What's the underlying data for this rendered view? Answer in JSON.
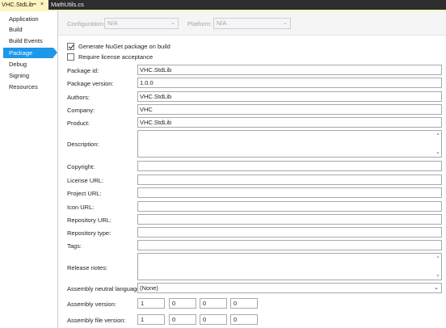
{
  "tabs": {
    "active": {
      "label": "VHC.StdLib",
      "pin": "⊸",
      "close": "×"
    },
    "inactive": {
      "label": "MathUtils.cs"
    }
  },
  "sidebar": {
    "items": [
      {
        "label": "Application"
      },
      {
        "label": "Build"
      },
      {
        "label": "Build Events"
      },
      {
        "label": "Package",
        "selected": true
      },
      {
        "label": "Debug"
      },
      {
        "label": "Signing"
      },
      {
        "label": "Resources"
      }
    ]
  },
  "config_bar": {
    "configuration_label": "Configuration:",
    "configuration_value": "N/A",
    "platform_label": "Platform:",
    "platform_value": "N/A"
  },
  "checks": {
    "generate_nuget": {
      "label": "Generate NuGet package on build",
      "checked": true
    },
    "require_license": {
      "label": "Require license acceptance",
      "checked": false
    }
  },
  "fields": {
    "package_id": {
      "label": "Package id:",
      "value": "VHC.StdLib"
    },
    "package_version": {
      "label": "Package version:",
      "value": "1.0.0"
    },
    "authors": {
      "label": "Authors:",
      "value": "VHC.StdLib"
    },
    "company": {
      "label": "Company:",
      "value": "VHC"
    },
    "product": {
      "label": "Product:",
      "value": "VHC.StdLib"
    },
    "description": {
      "label": "Description:",
      "value": ""
    },
    "copyright": {
      "label": "Copyright:",
      "value": ""
    },
    "license_url": {
      "label": "License URL:",
      "value": ""
    },
    "project_url": {
      "label": "Project URL:",
      "value": ""
    },
    "icon_url": {
      "label": "Icon URL:",
      "value": ""
    },
    "repository_url": {
      "label": "Repository URL:",
      "value": ""
    },
    "repository_type": {
      "label": "Repository type:",
      "value": ""
    },
    "tags": {
      "label": "Tags:",
      "value": ""
    },
    "release_notes": {
      "label": "Release notes:",
      "value": ""
    },
    "neutral_language": {
      "label": "Assembly neutral language:",
      "value": "(None)"
    }
  },
  "assembly_version": {
    "label": "Assembly version:",
    "parts": [
      "1",
      "0",
      "0",
      "0"
    ]
  },
  "assembly_file_version": {
    "label": "Assembly file version:",
    "parts": [
      "1",
      "0",
      "0",
      "0"
    ]
  },
  "icons": {
    "dropdown": "chevron-down-icon",
    "scroll_up": "triangle-up-icon",
    "scroll_down": "triangle-down-icon"
  },
  "colors": {
    "active_tab": "#fdf4bf",
    "tabstrip": "#2d2d30",
    "selection": "#1c97ea"
  }
}
